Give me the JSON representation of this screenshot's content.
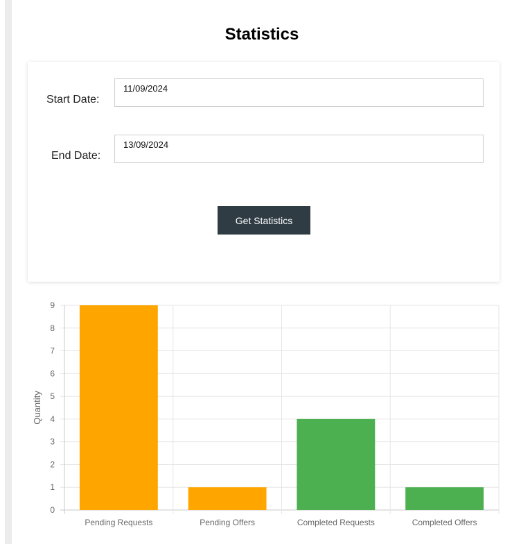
{
  "page": {
    "title": "Statistics"
  },
  "form": {
    "start_label": "Start Date:",
    "start_value": "11/09/2024",
    "end_label": "End Date:",
    "end_value": "13/09/2024",
    "submit_label": "Get Statistics"
  },
  "colors": {
    "pending": "#ffa500",
    "completed": "#4caf50",
    "button_bg": "#2f3c44"
  },
  "chart_data": {
    "type": "bar",
    "categories": [
      "Pending Requests",
      "Pending Offers",
      "Completed Requests",
      "Completed Offers"
    ],
    "values": [
      9,
      1,
      4,
      1
    ],
    "bar_colors": [
      "#ffa500",
      "#ffa500",
      "#4caf50",
      "#4caf50"
    ],
    "ylabel": "Quantity",
    "ylim": [
      0,
      9
    ],
    "yticks": [
      0,
      1,
      2,
      3,
      4,
      5,
      6,
      7,
      8,
      9
    ],
    "grid": true
  }
}
